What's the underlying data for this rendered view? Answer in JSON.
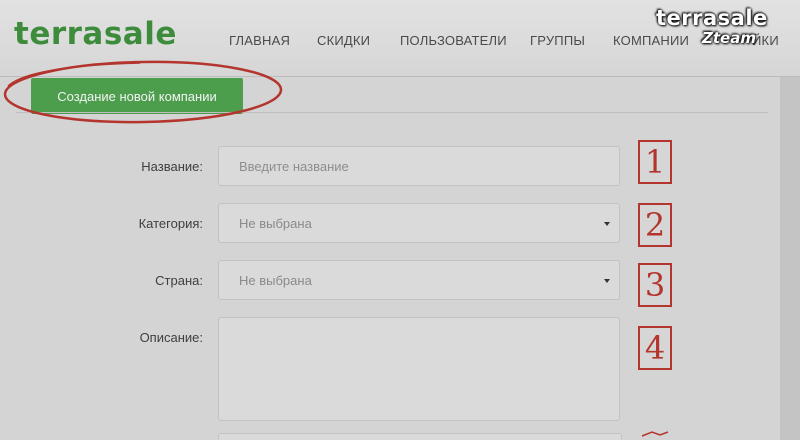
{
  "header": {
    "logo": "terrasale",
    "nav": [
      {
        "label": "ГЛАВНАЯ"
      },
      {
        "label": "СКИДКИ"
      },
      {
        "label": "ПОЛЬЗОВАТЕЛИ"
      },
      {
        "label": "ГРУППЫ"
      },
      {
        "label": "КОМПАНИИ"
      },
      {
        "label": "ЙКИ"
      }
    ]
  },
  "watermark": {
    "line1": "terrasale",
    "line2": "Zteam"
  },
  "page": {
    "create_button_label": "Создание новой компании"
  },
  "form": {
    "name": {
      "label": "Название:",
      "placeholder": "Введите название",
      "value": ""
    },
    "category": {
      "label": "Категория:",
      "value": "Не выбрана"
    },
    "country": {
      "label": "Страна:",
      "value": "Не выбрана"
    },
    "description": {
      "label": "Описание:",
      "value": ""
    }
  },
  "annotations": [
    "1",
    "2",
    "3",
    "4"
  ],
  "colors": {
    "brand_green": "#3c8c3c",
    "button_green": "#4c9d4c",
    "annotation_red": "#b4342e"
  }
}
